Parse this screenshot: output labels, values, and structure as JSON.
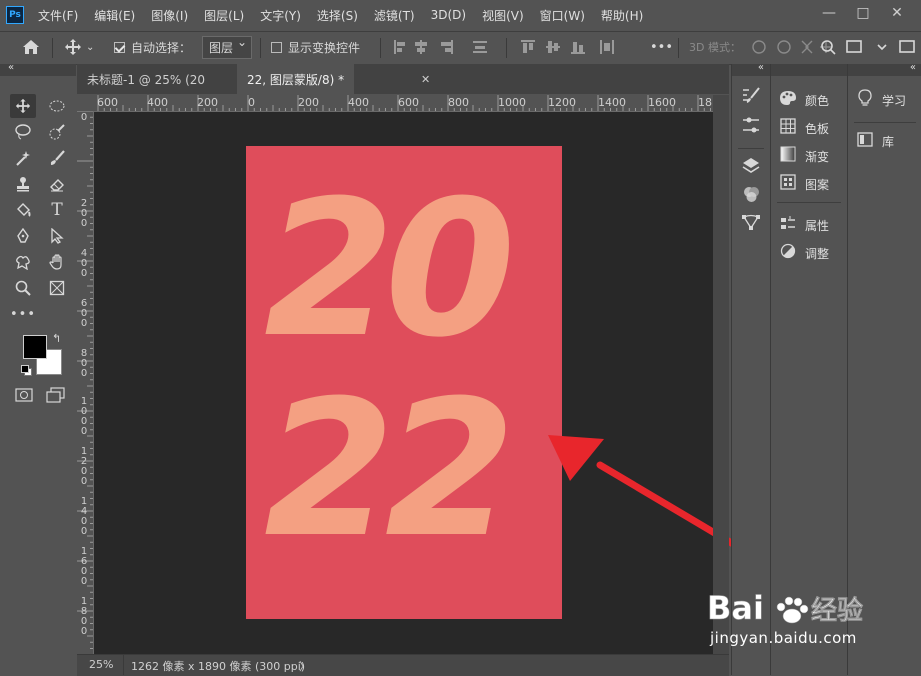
{
  "app": {
    "logo_text": "Ps"
  },
  "menu": [
    "文件(F)",
    "编辑(E)",
    "图像(I)",
    "图层(L)",
    "文字(Y)",
    "选择(S)",
    "滤镜(T)",
    "3D(D)",
    "视图(V)",
    "窗口(W)",
    "帮助(H)"
  ],
  "window_controls": {
    "minimize": "—",
    "maximize": "□",
    "close": "✕"
  },
  "options": {
    "auto_select_label": "自动选择：",
    "auto_select_checked": true,
    "auto_select_target": "图层",
    "show_transform_label": "显示变换控件",
    "show_transform_checked": false,
    "more": "•••",
    "mode_3d_label": "3D 模式："
  },
  "tabs": [
    {
      "label": "未标题-1 @ 25% (20",
      "active": false
    },
    {
      "label": "22, 图层蒙版/8) *",
      "active": true
    },
    {
      "close": "✕"
    }
  ],
  "ruler_top": [
    "600",
    "400",
    "200",
    "0",
    "200",
    "400",
    "600",
    "800",
    "1000",
    "1200",
    "1400",
    "1600",
    "18"
  ],
  "ruler_left": [
    "0",
    "2 0 0",
    "4 0 0",
    "6 0 0",
    "8 0 0",
    "1 0 0 0",
    "1 2 0 0",
    "1 4 0 0",
    "1 6 0 0",
    "1 8 0 0"
  ],
  "canvas": {
    "line1": "20",
    "line2": "22",
    "doc_color": "#df4d5b",
    "text_color": "#f4a082",
    "arrow_color": "#e8262c"
  },
  "status": {
    "zoom": "25%",
    "info": "1262 像素 x 1890 像素 (300 ppi)",
    "chevron": "〉"
  },
  "panels_a": [
    {
      "icon": "palette-icon",
      "label": "颜色"
    },
    {
      "icon": "grid-icon",
      "label": "色板"
    },
    {
      "icon": "gradient-icon",
      "label": "渐变"
    },
    {
      "icon": "pattern-icon",
      "label": "图案"
    },
    {
      "icon": "properties-icon",
      "label": "属性"
    },
    {
      "icon": "adjustments-icon",
      "label": "调整"
    }
  ],
  "panels_b": [
    {
      "icon": "lightbulb-icon",
      "label": "学习"
    },
    {
      "icon": "library-icon",
      "label": "库"
    }
  ],
  "collapse": "«",
  "watermark": {
    "brand": "Bai 经验",
    "url": "jingyan.baidu.com"
  }
}
